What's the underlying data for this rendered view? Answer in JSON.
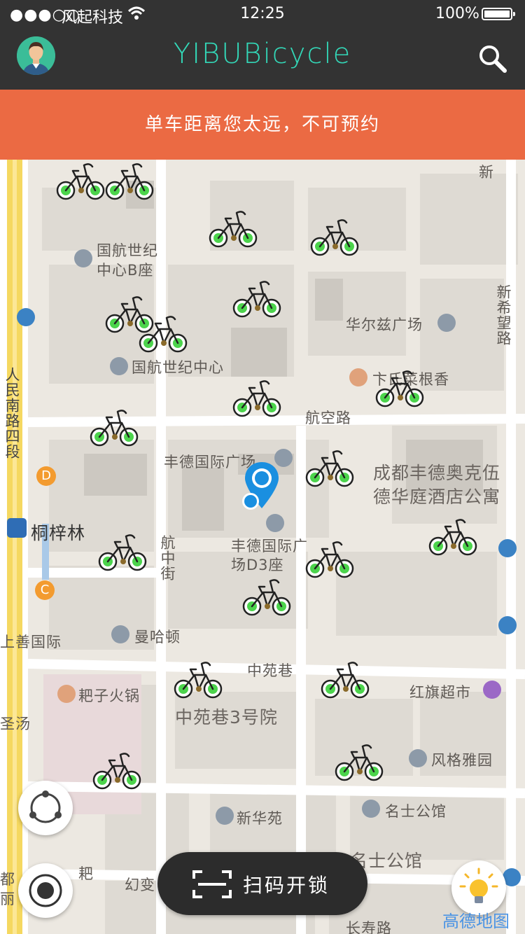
{
  "status_bar": {
    "signal": "●●●○○",
    "carrier": "风起科技",
    "time": "12:25",
    "battery": "100%"
  },
  "header": {
    "title": "YIBUBicycle"
  },
  "alert": {
    "message": "单车距离您太远，不可预约"
  },
  "map": {
    "labels": {
      "poi_1a": "国航世纪",
      "poi_1b": "中心B座",
      "poi_2": "国航世纪中心",
      "poi_3": "华尔兹广场",
      "poi_4": "卞氏菜根香",
      "road_1": "航空路",
      "poi_5": "丰德国际广场",
      "poi_6a": "成都丰德奥克伍",
      "poi_6b": "德华庭酒店公寓",
      "poi_7a": "丰德国际广",
      "poi_7b": "场D3座",
      "road_2": "航中街",
      "metro": "桐梓林",
      "road_3": "人民南路四段",
      "poi_8": "上善国际",
      "poi_9": "曼哈顿",
      "road_4": "中苑巷",
      "poi_10": "耙子火锅",
      "poi_11": "红旗超市",
      "poi_12": "中苑巷3号院",
      "poi_13": "风格雅园",
      "poi_14": "新华苑",
      "poi_15": "名士公馆",
      "poi_16": "名士公馆",
      "poi_17": "幻变",
      "poi_18": "长寿路",
      "poi_19": "耙",
      "poi_20": "圣汤",
      "road_5": "新希望路",
      "poi_21": "新",
      "edge_1": "都",
      "edge_2": "丽",
      "pin_d": "D",
      "pin_c": "C"
    }
  },
  "controls": {
    "scan_label": "扫码开锁",
    "amap_logo": "高德地图"
  },
  "colors": {
    "bar": "#333333",
    "accent": "#33d8b8",
    "alert": "#eb6a43",
    "pin": "#1a8fe0",
    "bike_wheel": "#4cd44c"
  }
}
